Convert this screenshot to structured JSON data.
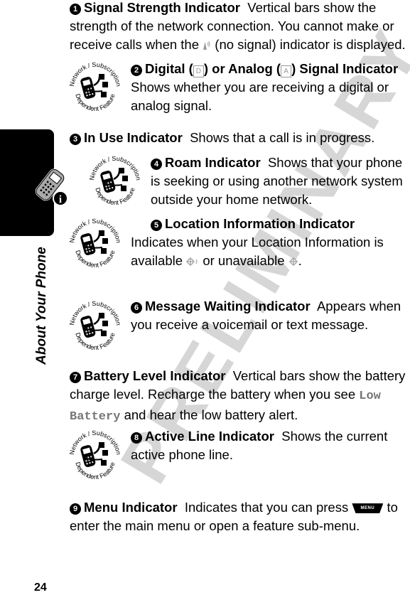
{
  "watermark": "PRELIMINARY",
  "section_label": "About Your Phone",
  "page_number": "24",
  "badge": {
    "top_text": "Network / Subscription",
    "bottom_text": "Dependent Feature"
  },
  "items": [
    {
      "number": "1",
      "title": "Signal Strength Indicator",
      "text_before_icon": "Vertical bars show the strength of the network connection. You cannot make or receive calls when the",
      "icon": "no-signal-icon",
      "text_after_icon": "(no signal) indicator is displayed.",
      "network_dependent": false
    },
    {
      "number": "2",
      "title_part1": "Digital (",
      "digital_glyph": "D",
      "title_part2": ") or Analog (",
      "analog_glyph": "A",
      "title_part3": ") Signal Indicator",
      "text": "Shows whether you are receiving a digital or analog signal.",
      "network_dependent": true
    },
    {
      "number": "3",
      "title": "In Use Indicator",
      "text": "Shows that a call is in progress.",
      "network_dependent": false
    },
    {
      "number": "4",
      "title": "Roam Indicator",
      "text": "Shows that your phone is seeking or using another network system outside your home network.",
      "network_dependent": true
    },
    {
      "number": "5",
      "title": "Location Information Indicator",
      "text_before": "Indicates when your Location Information is available",
      "available_icon": "location-available-icon",
      "text_middle": "or unavailable",
      "unavailable_icon": "location-unavailable-icon",
      "text_after": ".",
      "network_dependent": true
    },
    {
      "number": "6",
      "title": "Message Waiting Indicator",
      "text": "Appears when you receive a voicemail or text message.",
      "network_dependent": true
    },
    {
      "number": "7",
      "title": "Battery Level Indicator",
      "text_before": "Vertical bars show the battery charge level. Recharge the battery when you see",
      "display_text": "Low Battery",
      "text_after": "and hear the low battery alert.",
      "network_dependent": false
    },
    {
      "number": "8",
      "title": "Active Line Indicator",
      "text": "Shows the current active phone line.",
      "network_dependent": true
    },
    {
      "number": "9",
      "title": "Menu Indicator",
      "text_before": "Indicates that you can press",
      "key_label": "MENU",
      "text_after": "to enter the main menu or open a feature sub-menu.",
      "network_dependent": false
    }
  ]
}
